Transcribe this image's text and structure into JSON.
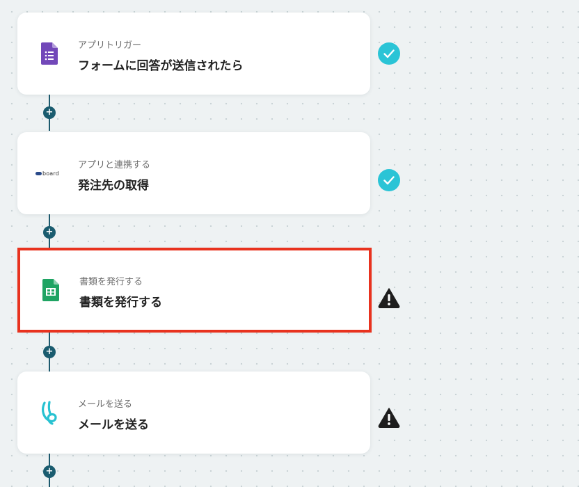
{
  "colors": {
    "accent_teal": "#1a5c6f",
    "check_cyan": "#2ac4d6",
    "selection_red": "#e8321e",
    "warning_dark": "#222222"
  },
  "add_button_glyph": "+",
  "steps": [
    {
      "subtitle": "アプリトリガー",
      "title": "フォームに回答が送信されたら",
      "app_icon": "google-forms-icon",
      "status": "complete",
      "status_icon": "check-circle-icon"
    },
    {
      "subtitle": "アプリと連携する",
      "title": "発注先の取得",
      "app_icon": "board-logo-icon",
      "app_icon_text": "board",
      "status": "complete",
      "status_icon": "check-circle-icon"
    },
    {
      "subtitle": "書類を発行する",
      "title": "書類を発行する",
      "app_icon": "google-sheets-icon",
      "status": "warning",
      "status_icon": "warning-triangle-icon",
      "selected": true
    },
    {
      "subtitle": "メールを送る",
      "title": "メールを送る",
      "app_icon": "yoom-mail-icon",
      "status": "warning",
      "status_icon": "warning-triangle-icon"
    }
  ]
}
